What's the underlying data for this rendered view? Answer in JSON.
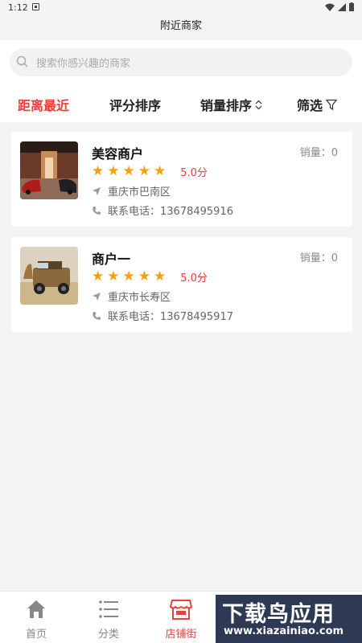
{
  "status": {
    "time": "1:12"
  },
  "header": {
    "title": "附近商家"
  },
  "search": {
    "placeholder": "搜索你感兴趣的商家"
  },
  "sort_tabs": [
    {
      "label": "距离最近",
      "active": true
    },
    {
      "label": "评分排序",
      "active": false
    },
    {
      "label": "销量排序",
      "active": false
    },
    {
      "label": "筛选",
      "active": false
    }
  ],
  "merchants": [
    {
      "name": "美容商户",
      "sales": "销量：0",
      "score": "5.0分",
      "stars": 5,
      "address": "重庆市巴南区",
      "phone": "联系电话：13678495916",
      "thumb": "car-showroom"
    },
    {
      "name": "商户一",
      "sales": "销量：0",
      "score": "5.0分",
      "stars": 5,
      "address": "重庆市长寿区",
      "phone": "联系电话：13678495917",
      "thumb": "jeep-desert"
    }
  ],
  "tabbar": [
    {
      "label": "首页",
      "icon": "home-icon",
      "active": false
    },
    {
      "label": "分类",
      "icon": "list-icon",
      "active": false
    },
    {
      "label": "店铺街",
      "icon": "store-icon",
      "active": true
    }
  ],
  "watermark": {
    "text": "下载鸟应用",
    "url": "www.xiazainiao.com"
  },
  "colors": {
    "accent": "#e8403c",
    "star": "#f6a00c"
  }
}
